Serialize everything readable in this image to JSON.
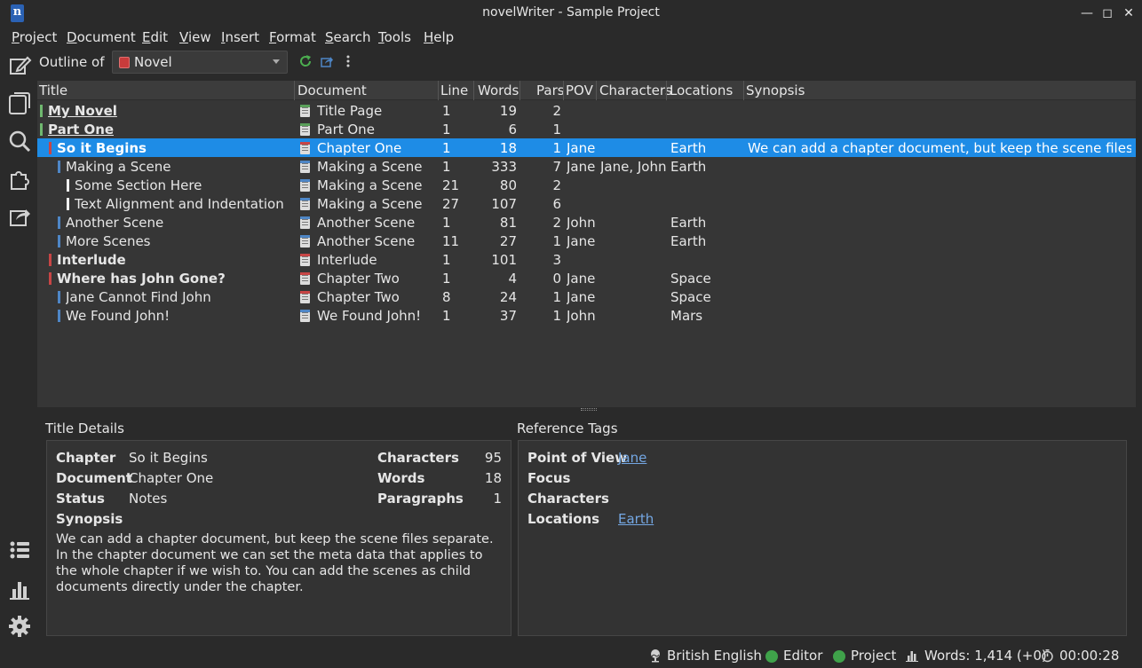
{
  "window": {
    "title": "novelWriter - Sample Project",
    "app_icon_letter": "n"
  },
  "menu": [
    "Project",
    "Document",
    "Edit",
    "View",
    "Insert",
    "Format",
    "Search",
    "Tools",
    "Help"
  ],
  "toolbar": {
    "outline_label": "Outline of",
    "root_selected": "Novel"
  },
  "columns": [
    "Title",
    "Document",
    "Line",
    "Words",
    "Pars",
    "POV",
    "Characters",
    "Locations",
    "Synopsis"
  ],
  "rows": [
    {
      "title": "My Novel",
      "document": "Title Page",
      "line": "1",
      "words": "19",
      "pars": "2",
      "pov": "",
      "characters": "",
      "locations": "",
      "synopsis": ""
    },
    {
      "title": "Part One",
      "document": "Part One",
      "line": "1",
      "words": "6",
      "pars": "1",
      "pov": "",
      "characters": "",
      "locations": "",
      "synopsis": ""
    },
    {
      "title": "So it Begins",
      "document": "Chapter One",
      "line": "1",
      "words": "18",
      "pars": "1",
      "pov": "Jane",
      "characters": "",
      "locations": "Earth",
      "synopsis": "We can add a chapter document, but keep the scene files separa…"
    },
    {
      "title": "Making a Scene",
      "document": "Making a Scene",
      "line": "1",
      "words": "333",
      "pars": "7",
      "pov": "Jane",
      "characters": "Jane, John",
      "locations": "Earth",
      "synopsis": ""
    },
    {
      "title": "Some Section Here",
      "document": "Making a Scene",
      "line": "21",
      "words": "80",
      "pars": "2",
      "pov": "",
      "characters": "",
      "locations": "",
      "synopsis": ""
    },
    {
      "title": "Text Alignment and Indentation",
      "document": "Making a Scene",
      "line": "27",
      "words": "107",
      "pars": "6",
      "pov": "",
      "characters": "",
      "locations": "",
      "synopsis": ""
    },
    {
      "title": "Another Scene",
      "document": "Another Scene",
      "line": "1",
      "words": "81",
      "pars": "2",
      "pov": "John",
      "characters": "",
      "locations": "Earth",
      "synopsis": ""
    },
    {
      "title": "More Scenes",
      "document": "Another Scene",
      "line": "11",
      "words": "27",
      "pars": "1",
      "pov": "Jane",
      "characters": "",
      "locations": "Earth",
      "synopsis": ""
    },
    {
      "title": "Interlude",
      "document": "Interlude",
      "line": "1",
      "words": "101",
      "pars": "3",
      "pov": "",
      "characters": "",
      "locations": "",
      "synopsis": ""
    },
    {
      "title": "Where has John Gone?",
      "document": "Chapter Two",
      "line": "1",
      "words": "4",
      "pars": "0",
      "pov": "Jane",
      "characters": "",
      "locations": "Space",
      "synopsis": ""
    },
    {
      "title": "Jane Cannot Find John",
      "document": "Chapter Two",
      "line": "8",
      "words": "24",
      "pars": "1",
      "pov": "Jane",
      "characters": "",
      "locations": "Space",
      "synopsis": ""
    },
    {
      "title": "We Found John!",
      "document": "We Found John!",
      "line": "1",
      "words": "37",
      "pars": "1",
      "pov": "John",
      "characters": "",
      "locations": "Mars",
      "synopsis": ""
    }
  ],
  "details": {
    "title": "Title Details",
    "chapter_label": "Chapter",
    "chapter_value": "So it Begins",
    "document_label": "Document",
    "document_value": "Chapter One",
    "status_label": "Status",
    "status_value": "Notes",
    "synopsis_label": "Synopsis",
    "synopsis_value": "We can add a chapter document, but keep the scene files separate. In the chapter document we can set the meta data that applies to the whole chapter if we wish to. You can add the scenes as child documents directly under the chapter.",
    "characters_label": "Characters",
    "characters_value": "95",
    "words_label": "Words",
    "words_value": "18",
    "paragraphs_label": "Paragraphs",
    "paragraphs_value": "1"
  },
  "tags": {
    "title": "Reference Tags",
    "pov_label": "Point of View",
    "pov_value": "Jane",
    "focus_label": "Focus",
    "characters_label": "Characters",
    "locations_label": "Locations",
    "locations_value": "Earth"
  },
  "status": {
    "language": "British English",
    "editor": "Editor",
    "project": "Project",
    "words": "Words: 1,414 (+0)",
    "time": "00:00:28"
  },
  "colors": {
    "selection": "#1e8ce6",
    "link": "#74a7e3",
    "status_ok": "#3fa24a"
  }
}
